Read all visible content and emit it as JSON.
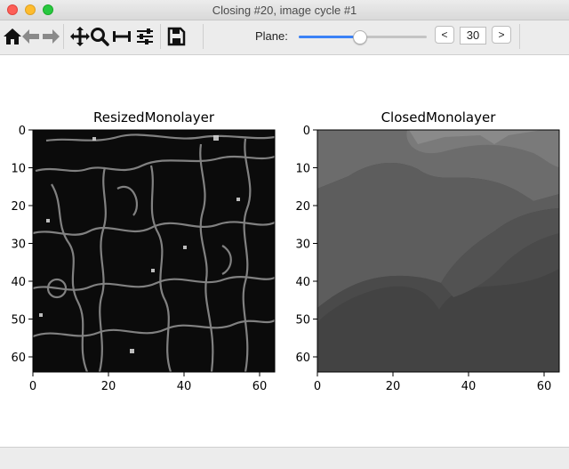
{
  "window": {
    "title": "Closing #20, image cycle #1"
  },
  "toolbar": {
    "tools": [
      "home-icon",
      "back-arrow-icon",
      "forward-arrow-icon",
      "pan-icon",
      "zoom-icon",
      "subplots-icon",
      "configure-icon",
      "save-icon"
    ],
    "plane_label": "Plane:",
    "plane_value": "30",
    "plane_fraction": 0.48,
    "prev_label": "<",
    "next_label": ">"
  },
  "colors": {
    "slider_accent": "#3b82f6",
    "close": "#fd5f57",
    "minimize": "#febc2e",
    "maximize": "#28c840"
  },
  "panels": [
    {
      "title": "ResizedMonolayer",
      "colormap": "gray",
      "xticks": [
        "0",
        "20",
        "40",
        "60"
      ],
      "yticks": [
        "0",
        "10",
        "20",
        "30",
        "40",
        "50",
        "60"
      ],
      "xlim": [
        0,
        64
      ],
      "ylim": [
        0,
        64
      ]
    },
    {
      "title": "ClosedMonolayer",
      "colormap": "gray",
      "xticks": [
        "0",
        "20",
        "40",
        "60"
      ],
      "yticks": [
        "0",
        "10",
        "20",
        "30",
        "40",
        "50",
        "60"
      ],
      "xlim": [
        0,
        64
      ],
      "ylim": [
        0,
        64
      ]
    }
  ]
}
